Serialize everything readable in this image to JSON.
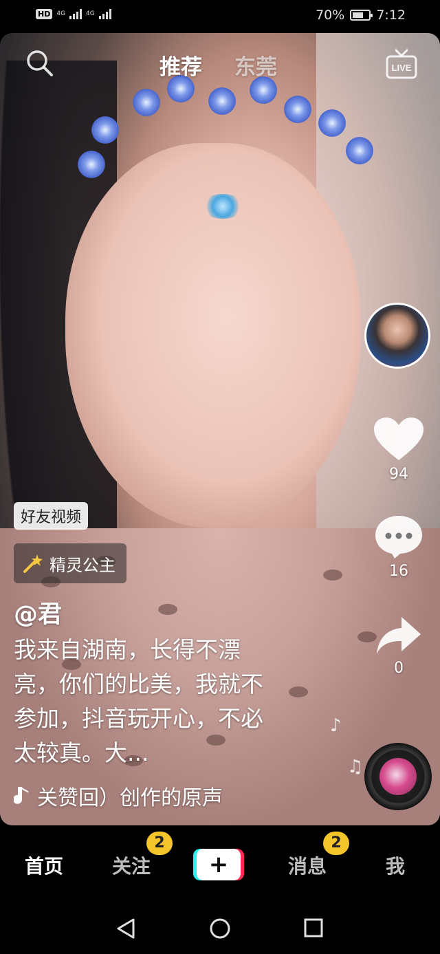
{
  "status_bar": {
    "network_hd": "HD",
    "network_1": "4G",
    "network_2": "4G",
    "battery_percent": "70%",
    "battery_level": 0.7,
    "time": "7:12"
  },
  "top_nav": {
    "search_icon": "search-icon",
    "tab_recommend": "推荐",
    "tab_local": "东莞",
    "live_icon": "live-tv-icon",
    "live_label": "LIVE"
  },
  "side_actions": {
    "like_count": "94",
    "comment_count": "16",
    "share_count": "0"
  },
  "video_info": {
    "friend_badge": "好友视频",
    "effect_name": "精灵公主",
    "username": "@君",
    "caption": "我来自湖南，长得不漂亮，你们的比美，我就不参加，抖音玩开心，不必太较真。大...",
    "music_title": "关赞回）创作的原声"
  },
  "bottom_nav": {
    "home": "首页",
    "following": "关注",
    "following_badge": "2",
    "messages": "消息",
    "messages_badge": "2",
    "me": "我",
    "plus": "+"
  },
  "colors": {
    "badge_yellow": "#f3c52b",
    "plus_cyan": "#25f4ee",
    "plus_red": "#fe2c55"
  }
}
